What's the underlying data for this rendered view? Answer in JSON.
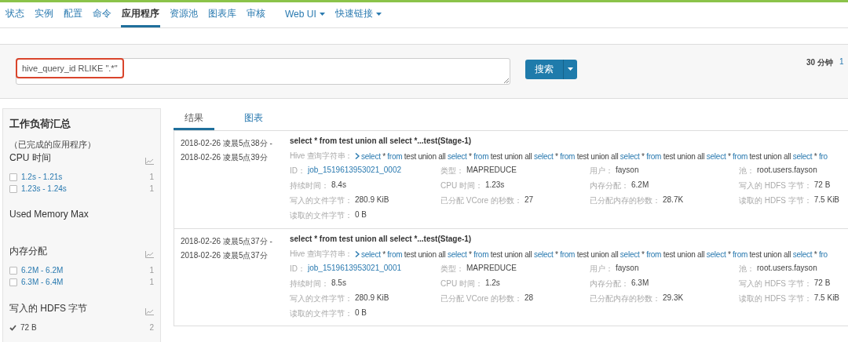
{
  "nav": {
    "tabs": [
      {
        "label": "状态",
        "selected": false,
        "dropdown": false
      },
      {
        "label": "实例",
        "selected": false,
        "dropdown": false
      },
      {
        "label": "配置",
        "selected": false,
        "dropdown": false
      },
      {
        "label": "命令",
        "selected": false,
        "dropdown": false
      },
      {
        "label": "应用程序",
        "selected": true,
        "dropdown": false
      },
      {
        "label": "资源池",
        "selected": false,
        "dropdown": false
      },
      {
        "label": "图表库",
        "selected": false,
        "dropdown": false
      },
      {
        "label": "审核",
        "selected": false,
        "dropdown": false
      },
      {
        "label": "Web UI",
        "selected": false,
        "dropdown": true
      },
      {
        "label": "快速链接",
        "selected": false,
        "dropdown": true
      }
    ]
  },
  "search": {
    "value": "hive_query_id RLIKE \".*\"",
    "button": "搜索",
    "time_range": "30 分钟",
    "time_link": "1"
  },
  "sidebar": {
    "title": "工作负荷汇总",
    "subtitle": "（已完成的应用程序）",
    "facets": [
      {
        "title": "CPU 时间",
        "chart": true,
        "options": [
          {
            "label": "1.2s - 1.21s",
            "count": "1",
            "checked": false
          },
          {
            "label": "1.23s - 1.24s",
            "count": "1",
            "checked": false
          }
        ]
      },
      {
        "title": "Used Memory Max",
        "chart": false
      },
      {
        "title": "内存分配",
        "chart": true,
        "options": [
          {
            "label": "6.2M - 6.2M",
            "count": "1",
            "checked": false
          },
          {
            "label": "6.3M - 6.4M",
            "count": "1",
            "checked": false
          }
        ]
      },
      {
        "title": "写入的 HDFS 字节",
        "chart": true,
        "options": [
          {
            "label": "72 B",
            "count": "2",
            "checked": true
          }
        ]
      }
    ]
  },
  "results": {
    "tabs": [
      {
        "label": "结果",
        "selected": true
      },
      {
        "label": "图表",
        "selected": false
      }
    ],
    "items": [
      {
        "start": "2018-02-26 凌晨5点38分 -",
        "end": "2018-02-26 凌晨5点39分",
        "title": "select * from test union all select *...test(Stage-1)",
        "query_label": "Hive 查询字符串：",
        "query": [
          {
            "text": "select",
            "kind": "keyword"
          },
          {
            "text": "*",
            "kind": "plain"
          },
          {
            "text": "from",
            "kind": "keyword"
          },
          {
            "text": "test union all",
            "kind": "plain"
          },
          {
            "text": "select",
            "kind": "keyword"
          },
          {
            "text": "*",
            "kind": "plain"
          },
          {
            "text": "from",
            "kind": "keyword"
          },
          {
            "text": "test union all",
            "kind": "plain"
          },
          {
            "text": "select",
            "kind": "keyword"
          },
          {
            "text": "*",
            "kind": "plain"
          },
          {
            "text": "from",
            "kind": "keyword"
          },
          {
            "text": "test union all",
            "kind": "plain"
          },
          {
            "text": "select",
            "kind": "keyword"
          },
          {
            "text": "*",
            "kind": "plain"
          },
          {
            "text": "from",
            "kind": "keyword"
          },
          {
            "text": "test union all",
            "kind": "plain"
          },
          {
            "text": "select",
            "kind": "keyword"
          },
          {
            "text": "*",
            "kind": "plain"
          },
          {
            "text": "from",
            "kind": "keyword"
          },
          {
            "text": "test union all",
            "kind": "plain"
          },
          {
            "text": "select",
            "kind": "keyword"
          },
          {
            "text": "*",
            "kind": "plain"
          },
          {
            "text": "fro",
            "kind": "keyword"
          }
        ],
        "fields": [
          {
            "label": "ID：",
            "value": "job_1519613953021_0002",
            "kind": "link"
          },
          {
            "label": "类型：",
            "value": "MAPREDUCE",
            "kind": "text"
          },
          {
            "label": "用户：",
            "value": "fayson",
            "kind": "text"
          },
          {
            "label": "池：",
            "value": "root.users.fayson",
            "kind": "text"
          },
          {
            "label": "持续时间：",
            "value": "8.4s",
            "kind": "text"
          },
          {
            "label": "CPU 时间：",
            "value": "1.23s",
            "kind": "text"
          },
          {
            "label": "内存分配：",
            "value": "6.2M",
            "kind": "text"
          },
          {
            "label": "写入的 HDFS 字节：",
            "value": "72 B",
            "kind": "text"
          },
          {
            "label": "写入的文件字节：",
            "value": "280.9 KiB",
            "kind": "text"
          },
          {
            "label": "已分配 VCore 的秒数：",
            "value": "27",
            "kind": "text"
          },
          {
            "label": "已分配内存的秒数：",
            "value": "28.7K",
            "kind": "text"
          },
          {
            "label": "读取的 HDFS 字节：",
            "value": "7.5 KiB",
            "kind": "text"
          },
          {
            "label": "读取的文件字节：",
            "value": "0 B",
            "kind": "text"
          }
        ]
      },
      {
        "start": "2018-02-26 凌晨5点37分 -",
        "end": "2018-02-26 凌晨5点37分",
        "title": "select * from test union all select *...test(Stage-1)",
        "query_label": "Hive 查询字符串：",
        "query": [
          {
            "text": "select",
            "kind": "keyword"
          },
          {
            "text": "*",
            "kind": "plain"
          },
          {
            "text": "from",
            "kind": "keyword"
          },
          {
            "text": "test union all",
            "kind": "plain"
          },
          {
            "text": "select",
            "kind": "keyword"
          },
          {
            "text": "*",
            "kind": "plain"
          },
          {
            "text": "from",
            "kind": "keyword"
          },
          {
            "text": "test union all",
            "kind": "plain"
          },
          {
            "text": "select",
            "kind": "keyword"
          },
          {
            "text": "*",
            "kind": "plain"
          },
          {
            "text": "from",
            "kind": "keyword"
          },
          {
            "text": "test union all",
            "kind": "plain"
          },
          {
            "text": "select",
            "kind": "keyword"
          },
          {
            "text": "*",
            "kind": "plain"
          },
          {
            "text": "from",
            "kind": "keyword"
          },
          {
            "text": "test union all",
            "kind": "plain"
          },
          {
            "text": "select",
            "kind": "keyword"
          },
          {
            "text": "*",
            "kind": "plain"
          },
          {
            "text": "from",
            "kind": "keyword"
          },
          {
            "text": "test union all",
            "kind": "plain"
          },
          {
            "text": "select",
            "kind": "keyword"
          },
          {
            "text": "*",
            "kind": "plain"
          },
          {
            "text": "fro",
            "kind": "keyword"
          }
        ],
        "fields": [
          {
            "label": "ID：",
            "value": "job_1519613953021_0001",
            "kind": "link"
          },
          {
            "label": "类型：",
            "value": "MAPREDUCE",
            "kind": "text"
          },
          {
            "label": "用户：",
            "value": "fayson",
            "kind": "text"
          },
          {
            "label": "池：",
            "value": "root.users.fayson",
            "kind": "text"
          },
          {
            "label": "持续时间：",
            "value": "8.5s",
            "kind": "text"
          },
          {
            "label": "CPU 时间：",
            "value": "1.2s",
            "kind": "text"
          },
          {
            "label": "内存分配：",
            "value": "6.3M",
            "kind": "text"
          },
          {
            "label": "写入的 HDFS 字节：",
            "value": "72 B",
            "kind": "text"
          },
          {
            "label": "写入的文件字节：",
            "value": "280.9 KiB",
            "kind": "text"
          },
          {
            "label": "已分配 VCore 的秒数：",
            "value": "28",
            "kind": "text"
          },
          {
            "label": "已分配内存的秒数：",
            "value": "29.3K",
            "kind": "text"
          },
          {
            "label": "读取的 HDFS 字节：",
            "value": "7.5 KiB",
            "kind": "text"
          },
          {
            "label": "读取的文件字节：",
            "value": "0 B",
            "kind": "text"
          }
        ]
      }
    ]
  }
}
